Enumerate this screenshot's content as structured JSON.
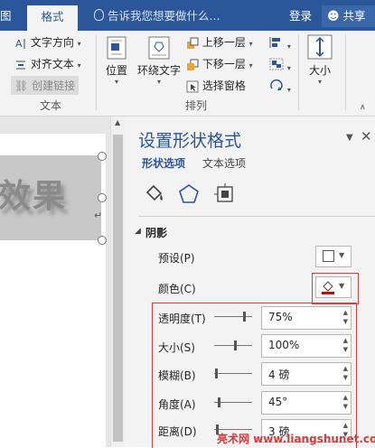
{
  "tabbar": {
    "left_tab": "图",
    "active_tab": "格式",
    "tell_me": "告诉我您想要做什么...",
    "login": "登录",
    "share": "共享"
  },
  "ribbon": {
    "text_direction": "文字方向",
    "align_text": "对齐文本",
    "create_link": "创建链接",
    "group_text": "文本",
    "position": "位置",
    "wrap_text": "环绕文字",
    "bring_forward": "上移一层",
    "send_backward": "下移一层",
    "selection_pane": "选择窗格",
    "group_arrange": "排列",
    "size": "大小"
  },
  "document": {
    "shape_text": "效果"
  },
  "pane": {
    "title": "设置形状格式",
    "tab_shape": "形状选项",
    "tab_text": "文本选项",
    "section": "阴影",
    "preset_label": "预设(P)",
    "color_label": "颜色(C)",
    "transparency_label": "透明度(T)",
    "transparency_value": "75%",
    "size_label": "大小(S)",
    "size_value": "100%",
    "blur_label": "模糊(B)",
    "blur_value": "4 磅",
    "angle_label": "角度(A)",
    "angle_value": "45°",
    "distance_label": "距离(D)",
    "distance_value": "3 磅",
    "shadow_color": "#c00000"
  },
  "watermark": "亮术网 www.liangshunet.com"
}
